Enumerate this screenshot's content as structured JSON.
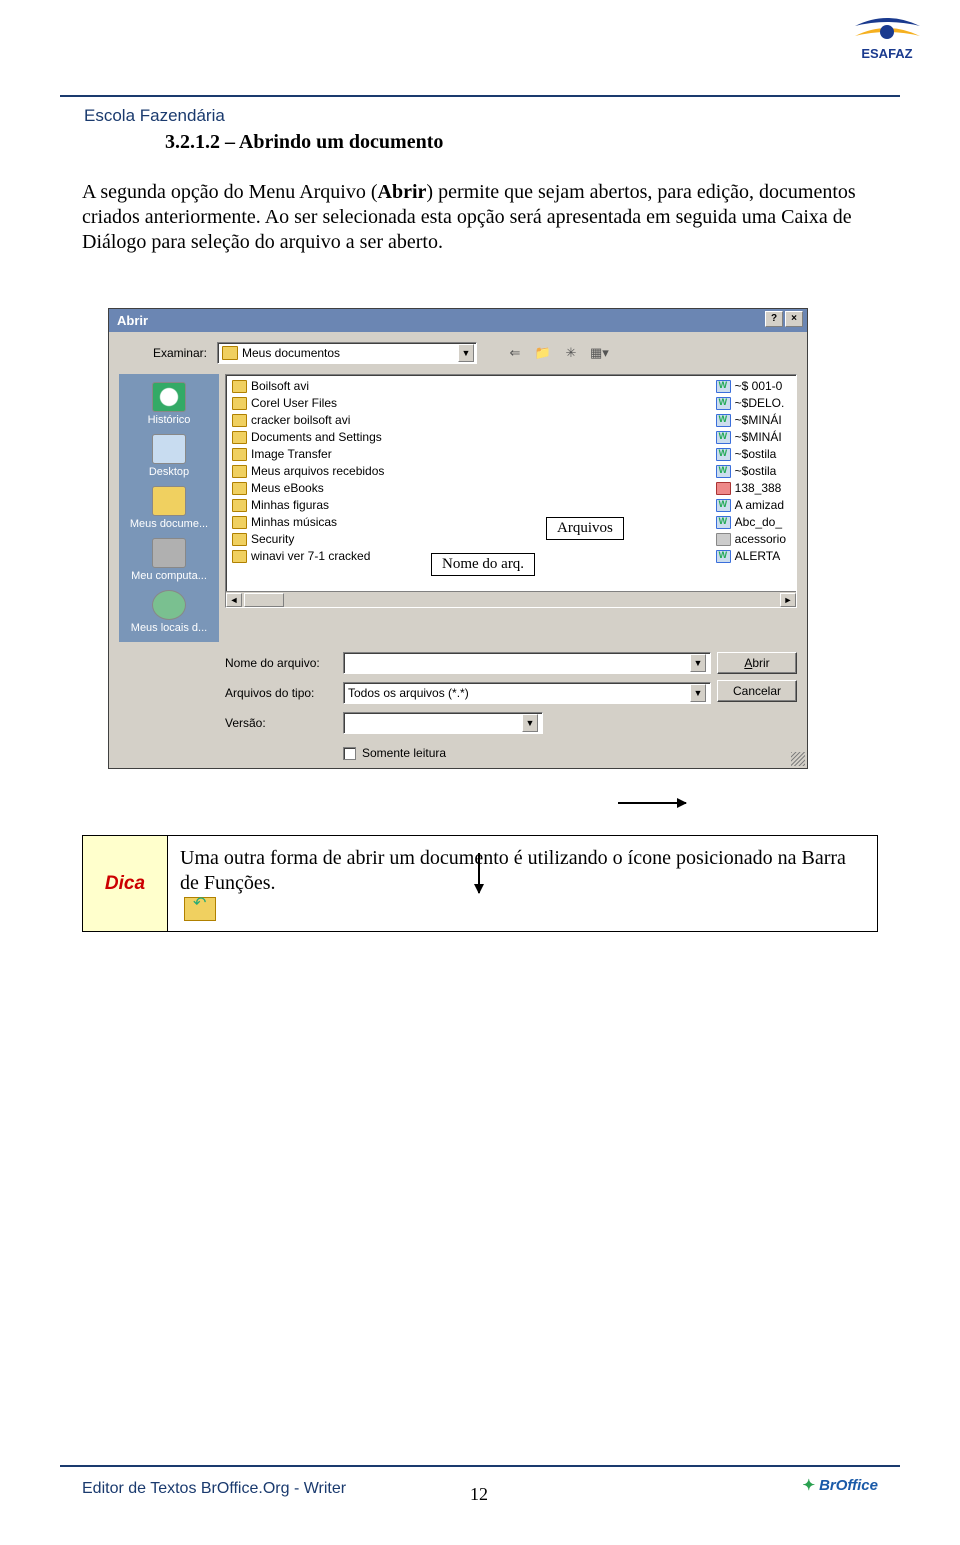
{
  "header": {
    "school": "Escola Fazendária",
    "logo_text_top": "ESAFAZ"
  },
  "section": {
    "number": "3.2.1.2 – Abrindo um documento"
  },
  "paragraph": {
    "p1a": "A segunda opção do Menu Arquivo (",
    "p1b": "Abrir",
    "p1c": ") permite que sejam abertos, para edição, documentos criados anteriormente. Ao ser selecionada esta opção será apresentada em seguida uma Caixa de Diálogo para seleção do arquivo a ser aberto."
  },
  "dialog": {
    "title": "Abrir",
    "examine_label": "Examinar:",
    "examine_value": "Meus documentos",
    "places": [
      {
        "label": "Histórico"
      },
      {
        "label": "Desktop"
      },
      {
        "label": "Meus docume..."
      },
      {
        "label": "Meu computa..."
      },
      {
        "label": "Meus locais d..."
      }
    ],
    "folders": [
      "Boilsoft avi",
      "Corel User Files",
      "cracker boilsoft avi",
      "Documents and Settings",
      "Image Transfer",
      "Meus arquivos recebidos",
      "Meus eBooks",
      "Minhas figuras",
      "Minhas músicas",
      "Security",
      "winavi ver 7-1 cracked"
    ],
    "files": [
      {
        "name": "~$ 001-0",
        "type": "word"
      },
      {
        "name": "~$DELO.",
        "type": "word"
      },
      {
        "name": "~$MINÁI",
        "type": "word"
      },
      {
        "name": "~$MINÁI",
        "type": "word"
      },
      {
        "name": "~$ostila",
        "type": "word"
      },
      {
        "name": "~$ostila",
        "type": "word"
      },
      {
        "name": "138_388",
        "type": "img"
      },
      {
        "name": "A amizad",
        "type": "word"
      },
      {
        "name": "Abc_do_",
        "type": "word"
      },
      {
        "name": "acessorio",
        "type": "misc"
      },
      {
        "name": "ALERTA",
        "type": "word"
      }
    ],
    "filename_label": "Nome do arquivo:",
    "filetype_label": "Arquivos do tipo:",
    "filetype_value": "Todos os arquivos (*.*)",
    "version_label": "Versão:",
    "readonly_label": "Somente leitura",
    "open_btn": "Abrir",
    "cancel_btn": "Cancelar"
  },
  "callouts": {
    "arquivos": "Arquivos",
    "nome": "Nome do arq."
  },
  "dica": {
    "label": "Dica",
    "text": "Uma outra forma de abrir um documento é utilizando o ícone posicionado na Barra de Funções."
  },
  "footer": {
    "text": "Editor de Textos BrOffice.Org  - Writer",
    "page": "12",
    "brand": "BrOffice"
  }
}
